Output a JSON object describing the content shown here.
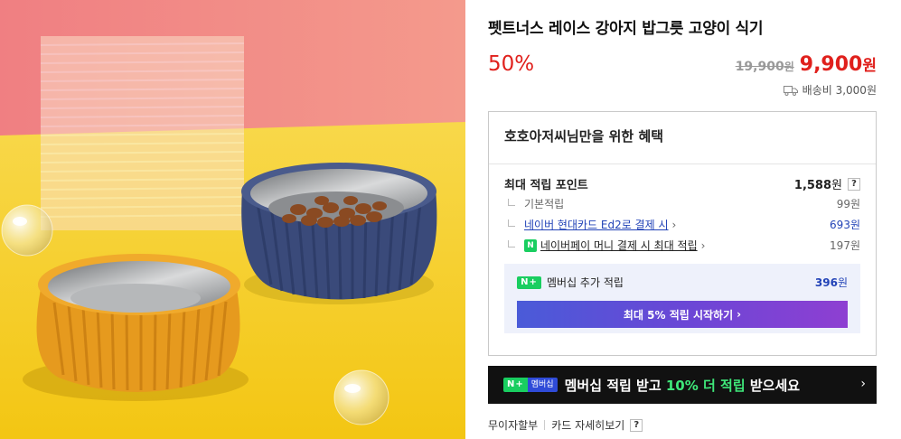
{
  "product": {
    "title": "펫트너스 레이스 강아지 밥그릇 고양이 식기",
    "discount": "50%",
    "original_price": "19,900",
    "original_price_unit": "원",
    "sale_price": "9,900",
    "sale_price_unit": "원",
    "shipping": "배송비 3,000원"
  },
  "benefit": {
    "title": "호호아저씨님만을 위한 혜택",
    "points_label": "최대 적립 포인트",
    "points_value": "1,588",
    "points_unit": "원",
    "help": "?",
    "rows": [
      {
        "label": "기본적립",
        "value": "99원"
      },
      {
        "label": "네이버 현대카드 Ed2로 결제 시",
        "value": "693원"
      },
      {
        "label": "네이버페이 머니 결제 시 최대 적립",
        "value": "197원"
      }
    ],
    "npay_icon": "N",
    "membership": {
      "badge": "N+",
      "label": "멤버십 추가 적립",
      "value": "396",
      "unit": "원",
      "button": "최대 5% 적립 시작하기"
    }
  },
  "banner": {
    "badge_left": "N+",
    "badge_right": "멤버십",
    "text_before": "멤버십 적립 받고 ",
    "text_highlight": "10% 더 적립",
    "text_after": " 받으세요"
  },
  "footer": {
    "link1": "무이자할부",
    "link2": "카드 자세히보기",
    "help": "?"
  },
  "colors": {
    "price_red": "#e0201c",
    "link_blue": "#2243b7",
    "naver_green": "#19ce60",
    "image_pink": "#f28b85",
    "image_yellow": "#f6d21b",
    "bowl_orange": "#e69a1e",
    "bowl_navy": "#3a4a7a"
  }
}
